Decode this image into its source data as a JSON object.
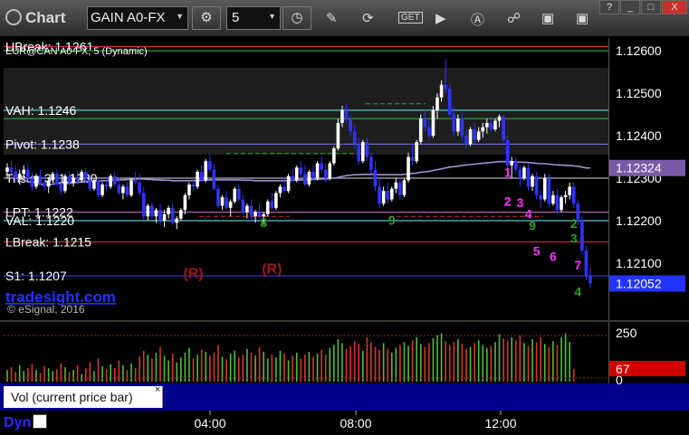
{
  "app": {
    "title": "Chart",
    "symbol": "GAIN A0-FX",
    "interval": "5"
  },
  "toolbar": [
    "settings-icon",
    "clock-icon",
    "pencil-icon",
    "refresh-icon",
    "get-icon",
    "play-icon",
    "alert-icon",
    "link-icon",
    "tile-icon",
    "cube-icon"
  ],
  "window_buttons": [
    "?",
    "_",
    "□",
    "X"
  ],
  "study_header": "EUR@CAN A0-FX, 5 (Dynamic)",
  "watermark": {
    "site": "tradesight.com",
    "copyright": "© eSignal, 2016"
  },
  "vol_panel": {
    "label": "Vol (current price bar)",
    "close": "×",
    "last": "67"
  },
  "footer": {
    "dyn": "Dyn"
  },
  "colors": {
    "bull": "#ffffff",
    "bear": "#2f34ff",
    "volUp": "#4fbf3a",
    "volDn": "#d23a2a",
    "lastPrice": "#2233ff",
    "volLast": "#d00000",
    "avg": "#a38ed8"
  },
  "chart_data": {
    "type": "candlestick",
    "price_axis": {
      "ylim": [
        1.1197,
        1.1263
      ],
      "ticks": [
        "1.12600",
        "1.12500",
        "1.12400",
        "1.12300",
        "1.12200",
        "1.12100"
      ],
      "last": "1.12052",
      "marker": "1.12324"
    },
    "time_axis": [
      "04:00",
      "08:00",
      "12:00"
    ],
    "volume_axis": {
      "ticks": [
        "250",
        "0"
      ]
    },
    "levels": [
      {
        "label": "UBreak: 1.1261",
        "value": 1.1261,
        "color": "#d22c2c"
      },
      {
        "label": "",
        "value": 1.126,
        "color": "#2aa02a"
      },
      {
        "label": "VAH: 1.1246",
        "value": 1.1246,
        "color": "#60c0d0"
      },
      {
        "label": "",
        "value": 1.1244,
        "color": "#2aa02a"
      },
      {
        "label": "Pivot: 1.1238",
        "value": 1.1238,
        "color": "#6b6be0"
      },
      {
        "label": "Tristar 3: 1.1230",
        "value": 1.123,
        "color": "#b0b0b0"
      },
      {
        "label": "LPT: 1.1222",
        "value": 1.1222,
        "color": "#c060c0"
      },
      {
        "label": "VAL: 1.1220",
        "value": 1.122,
        "color": "#60c0d0"
      },
      {
        "label": "LBreak: 1.1215",
        "value": 1.1215,
        "color": "#d22c2c"
      },
      {
        "label": "S1: 1.1207",
        "value": 1.1207,
        "color": "#3030c0"
      }
    ],
    "annotations": [
      {
        "text": "(R)",
        "x_index": 45,
        "value": 1.12065,
        "color": "#9a1c1c"
      },
      {
        "text": "(R)",
        "x_index": 64,
        "value": 1.12075,
        "color": "#9a1c1c"
      },
      {
        "text": "1",
        "x_index": 121,
        "value": 1.12303,
        "color": "#ff30ff"
      },
      {
        "text": "2",
        "x_index": 121,
        "value": 1.12235,
        "color": "#ff30ff"
      },
      {
        "text": "3",
        "x_index": 124,
        "value": 1.12232,
        "color": "#ff30ff"
      },
      {
        "text": "4",
        "x_index": 126,
        "value": 1.12205,
        "color": "#ff30ff"
      },
      {
        "text": "5",
        "x_index": 128,
        "value": 1.12118,
        "color": "#ff30ff"
      },
      {
        "text": "6",
        "x_index": 132,
        "value": 1.12105,
        "color": "#ff30ff"
      },
      {
        "text": "7",
        "x_index": 138,
        "value": 1.12085,
        "color": "#ff30ff"
      },
      {
        "text": "8",
        "x_index": 62,
        "value": 1.12185,
        "color": "#2aa02a"
      },
      {
        "text": "9",
        "x_index": 93,
        "value": 1.1219,
        "color": "#2aa02a"
      },
      {
        "text": "9",
        "x_index": 127,
        "value": 1.12178,
        "color": "#2aa02a"
      },
      {
        "text": "2",
        "x_index": 137,
        "value": 1.12183,
        "color": "#2aa02a"
      },
      {
        "text": "3",
        "x_index": 137,
        "value": 1.12148,
        "color": "#2aa02a"
      },
      {
        "text": "4",
        "x_index": 138,
        "value": 1.12022,
        "color": "#2aa02a"
      }
    ],
    "candles": [
      [
        1.12315,
        1.12335,
        1.123,
        1.12325
      ],
      [
        1.12325,
        1.1234,
        1.1231,
        1.12315
      ],
      [
        1.12315,
        1.1233,
        1.1229,
        1.123
      ],
      [
        1.123,
        1.1232,
        1.12285,
        1.1231
      ],
      [
        1.1231,
        1.1233,
        1.123,
        1.1232
      ],
      [
        1.1232,
        1.12335,
        1.12295,
        1.123
      ],
      [
        1.123,
        1.12315,
        1.1227,
        1.1228
      ],
      [
        1.1228,
        1.1231,
        1.12275,
        1.12305
      ],
      [
        1.12305,
        1.1232,
        1.12285,
        1.1229
      ],
      [
        1.1229,
        1.12305,
        1.1227,
        1.1228
      ],
      [
        1.1228,
        1.123,
        1.12265,
        1.12295
      ],
      [
        1.12295,
        1.12315,
        1.1229,
        1.1231
      ],
      [
        1.1231,
        1.1232,
        1.1228,
        1.12285
      ],
      [
        1.12285,
        1.123,
        1.1226,
        1.1227
      ],
      [
        1.1227,
        1.1231,
        1.12265,
        1.12305
      ],
      [
        1.12305,
        1.12315,
        1.12285,
        1.1229
      ],
      [
        1.1229,
        1.1231,
        1.1228,
        1.123
      ],
      [
        1.123,
        1.12315,
        1.12285,
        1.12295
      ],
      [
        1.12295,
        1.1232,
        1.1229,
        1.12315
      ],
      [
        1.12315,
        1.12325,
        1.1229,
        1.12295
      ],
      [
        1.12295,
        1.12305,
        1.1227,
        1.12275
      ],
      [
        1.12275,
        1.123,
        1.1227,
        1.12295
      ],
      [
        1.12295,
        1.123,
        1.12255,
        1.1226
      ],
      [
        1.1226,
        1.1229,
        1.12255,
        1.12285
      ],
      [
        1.12285,
        1.123,
        1.1227,
        1.1228
      ],
      [
        1.1228,
        1.1231,
        1.12275,
        1.12305
      ],
      [
        1.12305,
        1.12315,
        1.1228,
        1.12285
      ],
      [
        1.12285,
        1.123,
        1.1226,
        1.12265
      ],
      [
        1.12265,
        1.12285,
        1.1225,
        1.1228
      ],
      [
        1.1228,
        1.1229,
        1.12255,
        1.1226
      ],
      [
        1.1226,
        1.123,
        1.12255,
        1.12295
      ],
      [
        1.12295,
        1.12315,
        1.12285,
        1.1229
      ],
      [
        1.1229,
        1.1231,
        1.1226,
        1.12265
      ],
      [
        1.12265,
        1.1228,
        1.122,
        1.1221
      ],
      [
        1.1221,
        1.1224,
        1.122,
        1.12235
      ],
      [
        1.12235,
        1.12245,
        1.12205,
        1.1221
      ],
      [
        1.1221,
        1.1223,
        1.12195,
        1.12225
      ],
      [
        1.12225,
        1.1224,
        1.1219,
        1.122
      ],
      [
        1.122,
        1.12225,
        1.12185,
        1.12215
      ],
      [
        1.12215,
        1.12235,
        1.12205,
        1.1223
      ],
      [
        1.1223,
        1.1224,
        1.1219,
        1.12195
      ],
      [
        1.12195,
        1.1221,
        1.1218,
        1.12205
      ],
      [
        1.12205,
        1.1223,
        1.122,
        1.12225
      ],
      [
        1.12225,
        1.12265,
        1.12215,
        1.1226
      ],
      [
        1.1226,
        1.1229,
        1.1225,
        1.12285
      ],
      [
        1.12285,
        1.123,
        1.1227,
        1.1228
      ],
      [
        1.1228,
        1.1232,
        1.12275,
        1.12315
      ],
      [
        1.12315,
        1.1233,
        1.1229,
        1.12295
      ],
      [
        1.12295,
        1.12345,
        1.1229,
        1.1234
      ],
      [
        1.1234,
        1.12355,
        1.12315,
        1.1232
      ],
      [
        1.1232,
        1.12335,
        1.1227,
        1.12275
      ],
      [
        1.12275,
        1.12285,
        1.1223,
        1.12235
      ],
      [
        1.12235,
        1.1226,
        1.12225,
        1.12255
      ],
      [
        1.12255,
        1.1227,
        1.12225,
        1.1223
      ],
      [
        1.1223,
        1.1225,
        1.1221,
        1.12245
      ],
      [
        1.12245,
        1.1228,
        1.1224,
        1.12275
      ],
      [
        1.12275,
        1.12285,
        1.12245,
        1.1225
      ],
      [
        1.1225,
        1.1226,
        1.12215,
        1.1222
      ],
      [
        1.1222,
        1.1224,
        1.12205,
        1.12235
      ],
      [
        1.12235,
        1.1225,
        1.122,
        1.1221
      ],
      [
        1.1221,
        1.12225,
        1.12195,
        1.1222
      ],
      [
        1.1222,
        1.1224,
        1.12205,
        1.1221
      ],
      [
        1.1221,
        1.1222,
        1.1219,
        1.12215
      ],
      [
        1.12215,
        1.1225,
        1.1221,
        1.12245
      ],
      [
        1.12245,
        1.12265,
        1.12225,
        1.1223
      ],
      [
        1.1223,
        1.1227,
        1.12225,
        1.12265
      ],
      [
        1.12265,
        1.12285,
        1.12255,
        1.1228
      ],
      [
        1.1228,
        1.123,
        1.12265,
        1.1227
      ],
      [
        1.1227,
        1.1231,
        1.12265,
        1.12305
      ],
      [
        1.12305,
        1.1232,
        1.1229,
        1.12295
      ],
      [
        1.12295,
        1.1233,
        1.1229,
        1.12325
      ],
      [
        1.12325,
        1.1234,
        1.123,
        1.1231
      ],
      [
        1.1231,
        1.1233,
        1.1228,
        1.12285
      ],
      [
        1.12285,
        1.1232,
        1.1228,
        1.12315
      ],
      [
        1.12315,
        1.1233,
        1.12295,
        1.123
      ],
      [
        1.123,
        1.1234,
        1.12295,
        1.12335
      ],
      [
        1.12335,
        1.1235,
        1.1231,
        1.1232
      ],
      [
        1.1232,
        1.12335,
        1.1229,
        1.123
      ],
      [
        1.123,
        1.1234,
        1.12295,
        1.12335
      ],
      [
        1.12335,
        1.12375,
        1.1233,
        1.1237
      ],
      [
        1.1237,
        1.1244,
        1.12365,
        1.1243
      ],
      [
        1.1243,
        1.1247,
        1.1242,
        1.1246
      ],
      [
        1.1246,
        1.12475,
        1.1243,
        1.1244
      ],
      [
        1.1244,
        1.1245,
        1.124,
        1.1241
      ],
      [
        1.1241,
        1.12425,
        1.1237,
        1.1238
      ],
      [
        1.1238,
        1.12395,
        1.1233,
        1.1234
      ],
      [
        1.1234,
        1.1239,
        1.12335,
        1.12385
      ],
      [
        1.12385,
        1.12395,
        1.1234,
        1.1235
      ],
      [
        1.1235,
        1.1236,
        1.1231,
        1.1232
      ],
      [
        1.1232,
        1.1234,
        1.1227,
        1.1228
      ],
      [
        1.1228,
        1.123,
        1.1223,
        1.1224
      ],
      [
        1.1224,
        1.1228,
        1.12235,
        1.1227
      ],
      [
        1.1227,
        1.1229,
        1.1224,
        1.1225
      ],
      [
        1.1225,
        1.1228,
        1.12245,
        1.12275
      ],
      [
        1.12275,
        1.123,
        1.12265,
        1.1229
      ],
      [
        1.1229,
        1.123,
        1.1225,
        1.1226
      ],
      [
        1.1226,
        1.123,
        1.12255,
        1.12295
      ],
      [
        1.12295,
        1.1236,
        1.1229,
        1.1235
      ],
      [
        1.1235,
        1.1238,
        1.1233,
        1.1234
      ],
      [
        1.1234,
        1.1239,
        1.12335,
        1.12385
      ],
      [
        1.12385,
        1.1245,
        1.1238,
        1.1244
      ],
      [
        1.1244,
        1.1246,
        1.1241,
        1.1242
      ],
      [
        1.1242,
        1.1244,
        1.1239,
        1.124
      ],
      [
        1.124,
        1.1247,
        1.12395,
        1.1246
      ],
      [
        1.1246,
        1.125,
        1.1244,
        1.1249
      ],
      [
        1.1249,
        1.1253,
        1.1248,
        1.1252
      ],
      [
        1.1252,
        1.1258,
        1.125,
        1.1251
      ],
      [
        1.1251,
        1.1252,
        1.1244,
        1.1245
      ],
      [
        1.1245,
        1.1247,
        1.124,
        1.1241
      ],
      [
        1.1241,
        1.1245,
        1.124,
        1.1244
      ],
      [
        1.1244,
        1.12455,
        1.1239,
        1.124
      ],
      [
        1.124,
        1.12415,
        1.1237,
        1.1238
      ],
      [
        1.1238,
        1.1242,
        1.12375,
        1.12415
      ],
      [
        1.12415,
        1.1243,
        1.1238,
        1.1239
      ],
      [
        1.1239,
        1.1242,
        1.12385,
        1.1241
      ],
      [
        1.1241,
        1.1243,
        1.12395,
        1.1242
      ],
      [
        1.1242,
        1.1244,
        1.12405,
        1.1243
      ],
      [
        1.1243,
        1.12445,
        1.1241,
        1.12415
      ],
      [
        1.12415,
        1.1244,
        1.1241,
        1.12435
      ],
      [
        1.12435,
        1.1245,
        1.1242,
        1.12445
      ],
      [
        1.12445,
        1.1245,
        1.1238,
        1.1239
      ],
      [
        1.1239,
        1.124,
        1.1232,
        1.1233
      ],
      [
        1.1233,
        1.1235,
        1.123,
        1.1234
      ],
      [
        1.1234,
        1.1235,
        1.1231,
        1.1232
      ],
      [
        1.1232,
        1.1233,
        1.1228,
        1.123
      ],
      [
        1.123,
        1.1233,
        1.12295,
        1.12325
      ],
      [
        1.12325,
        1.12335,
        1.1227,
        1.1228
      ],
      [
        1.1228,
        1.1231,
        1.1227,
        1.12305
      ],
      [
        1.12305,
        1.12315,
        1.1225,
        1.1226
      ],
      [
        1.1226,
        1.1227,
        1.1223,
        1.1225
      ],
      [
        1.1225,
        1.1231,
        1.12245,
        1.123
      ],
      [
        1.123,
        1.1231,
        1.1223,
        1.1224
      ],
      [
        1.1224,
        1.1227,
        1.12235,
        1.1226
      ],
      [
        1.1226,
        1.12275,
        1.12215,
        1.12225
      ],
      [
        1.12225,
        1.1226,
        1.1222,
        1.12255
      ],
      [
        1.12255,
        1.1227,
        1.1224,
        1.1226
      ],
      [
        1.1226,
        1.1229,
        1.1225,
        1.1228
      ],
      [
        1.1228,
        1.1229,
        1.1223,
        1.1224
      ],
      [
        1.1224,
        1.1225,
        1.1219,
        1.122
      ],
      [
        1.122,
        1.1221,
        1.1212,
        1.1213
      ],
      [
        1.1213,
        1.1214,
        1.1206,
        1.1207
      ],
      [
        1.1207,
        1.1209,
        1.1204,
        1.12052
      ]
    ],
    "volume": [
      60,
      75,
      50,
      85,
      55,
      70,
      90,
      60,
      45,
      80,
      70,
      55,
      65,
      95,
      75,
      50,
      60,
      85,
      40,
      70,
      100,
      55,
      120,
      80,
      65,
      90,
      70,
      110,
      85,
      60,
      95,
      70,
      130,
      160,
      140,
      120,
      150,
      180,
      135,
      110,
      145,
      100,
      125,
      150,
      175,
      120,
      140,
      165,
      155,
      135,
      150,
      190,
      130,
      115,
      145,
      160,
      125,
      140,
      170,
      150,
      135,
      180,
      155,
      120,
      140,
      125,
      160,
      145,
      110,
      135,
      150,
      120,
      140,
      155,
      130,
      145,
      165,
      140,
      175,
      190,
      220,
      200,
      170,
      185,
      210,
      195,
      160,
      230,
      205,
      180,
      165,
      200,
      170,
      150,
      175,
      190,
      205,
      185,
      215,
      230,
      195,
      180,
      200,
      225,
      240,
      250,
      210,
      190,
      205,
      220,
      195,
      170,
      180,
      200,
      215,
      190,
      175,
      185,
      205,
      245,
      225,
      210,
      230,
      215,
      240,
      200,
      185,
      220,
      205,
      230,
      195,
      180,
      210,
      190,
      230,
      250,
      205,
      67
    ],
    "avg": [
      1.123,
      1.123,
      1.123,
      1.12298,
      1.12295,
      1.12292,
      1.1229,
      1.12288,
      1.12286,
      1.12285,
      1.12285,
      1.12286,
      1.12287,
      1.12288,
      1.12288,
      1.12288,
      1.12289,
      1.1229,
      1.12291,
      1.12292,
      1.12292,
      1.12293,
      1.12293,
      1.12294,
      1.12294,
      1.12295,
      1.12295,
      1.12296,
      1.12296,
      1.12297,
      1.12297,
      1.12298,
      1.12298,
      1.12298,
      1.12297,
      1.12297,
      1.12296,
      1.12296,
      1.12295,
      1.12295,
      1.12294,
      1.12294,
      1.12294,
      1.12294,
      1.12294,
      1.12294,
      1.12294,
      1.12295,
      1.12295,
      1.12296,
      1.12296,
      1.12296,
      1.12296,
      1.12296,
      1.12296,
      1.12296,
      1.12296,
      1.12295,
      1.12295,
      1.12295,
      1.12294,
      1.12294,
      1.12294,
      1.12294,
      1.12294,
      1.12294,
      1.12294,
      1.12294,
      1.12294,
      1.12295,
      1.12295,
      1.12296,
      1.12296,
      1.12296,
      1.12297,
      1.12297,
      1.12298,
      1.12298,
      1.12299,
      1.123,
      1.12302,
      1.12304,
      1.12306,
      1.12307,
      1.12308,
      1.12308,
      1.12309,
      1.12309,
      1.12309,
      1.12309,
      1.12308,
      1.12308,
      1.12308,
      1.12308,
      1.12308,
      1.12308,
      1.12309,
      1.1231,
      1.12311,
      1.12312,
      1.12314,
      1.12315,
      1.12316,
      1.12318,
      1.1232,
      1.12322,
      1.12324,
      1.12326,
      1.12327,
      1.12328,
      1.1233,
      1.12331,
      1.12332,
      1.12333,
      1.12334,
      1.12335,
      1.12336,
      1.12337,
      1.12338,
      1.12339,
      1.12339,
      1.12339,
      1.12339,
      1.12338,
      1.12338,
      1.12337,
      1.12337,
      1.12336,
      1.12335,
      1.12334,
      1.12334,
      1.12333,
      1.12332,
      1.12331,
      1.12331,
      1.1233,
      1.1233,
      1.12329,
      1.12328,
      1.12326,
      1.12324,
      1.12324
    ]
  }
}
